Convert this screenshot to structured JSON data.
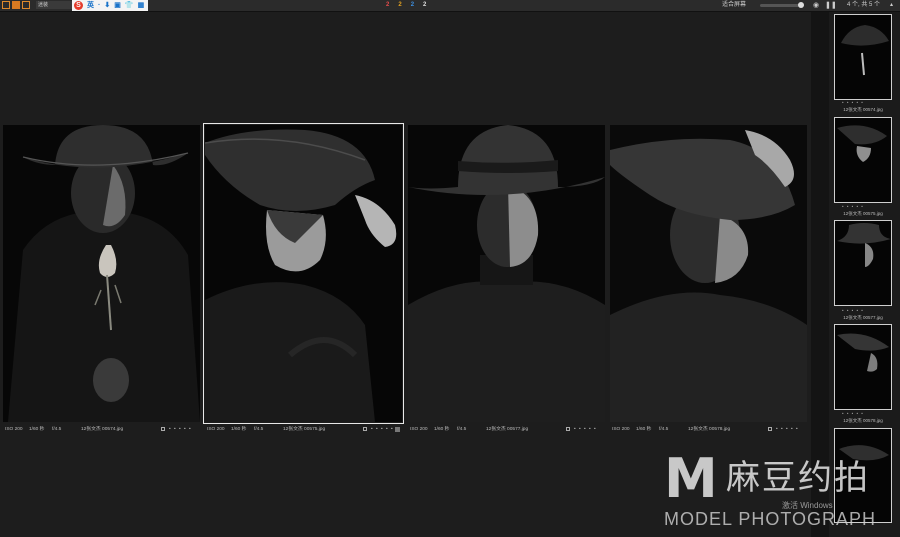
{
  "toolbar": {
    "mode_label": "迷装",
    "ime_items": [
      "英",
      "·",
      "⬇",
      "▣",
      "👕",
      "▦"
    ],
    "counts": [
      "2",
      "2",
      "2",
      "2"
    ],
    "count_colors": [
      "#e34b4b",
      "#e0a020",
      "#3d8fe0",
      "#dddddd"
    ],
    "fit_label": "适合屏幕",
    "total_label": "4 个, 共 5 个"
  },
  "photos": [
    {
      "iso": "ISO 200",
      "shutter": "1/60 秒",
      "aperture": "f/4.5",
      "file": "12张文杰 00574.jpg",
      "selected": false
    },
    {
      "iso": "ISO 200",
      "shutter": "1/60 秒",
      "aperture": "f/4.5",
      "file": "12张文杰 00575.jpg",
      "selected": true
    },
    {
      "iso": "ISO 200",
      "shutter": "1/60 秒",
      "aperture": "f/4.5",
      "file": "12张文杰 00577.jpg",
      "selected": false
    },
    {
      "iso": "ISO 200",
      "shutter": "1/60 秒",
      "aperture": "f/4.5",
      "file": "12张文杰 00578.jpg",
      "selected": false
    }
  ],
  "filmstrip": [
    {
      "file": "12张文杰 00574.jpg"
    },
    {
      "file": "12张文杰 00575.jpg"
    },
    {
      "file": "12张文杰 00577.jpg"
    },
    {
      "file": "12张文杰 00578.jpg"
    },
    {
      "file": ""
    }
  ],
  "rating_dots": "• • • • •",
  "watermark": {
    "mark": "M",
    "cn": "麻豆约拍",
    "en": "MODEL PHOTOGRAPH"
  },
  "os_notice": "激活 Windows"
}
